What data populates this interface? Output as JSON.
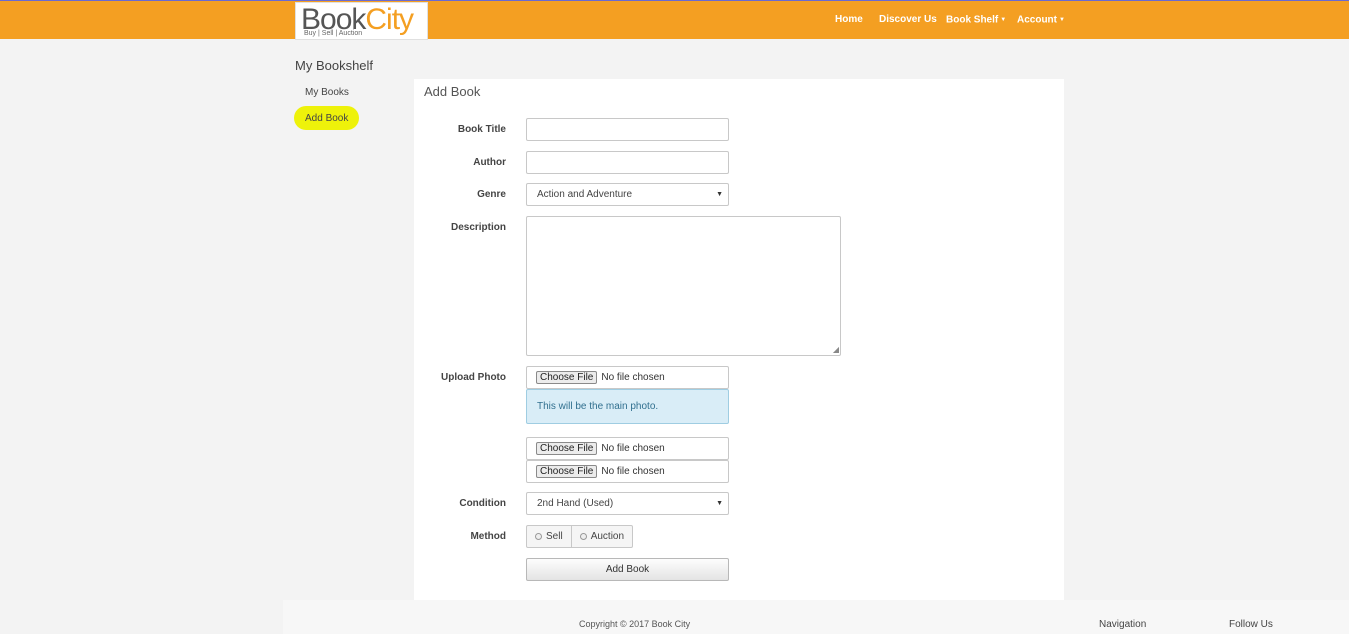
{
  "brand": {
    "name_part1": "Book",
    "name_part2": "City",
    "tagline": "Buy | Sell | Auction"
  },
  "nav": {
    "home": "Home",
    "discover": "Discover Us",
    "bookshelf": "Book Shelf",
    "account": "Account",
    "dropdown_caret": "▼"
  },
  "sidebar": {
    "title": "My Bookshelf",
    "items": [
      {
        "label": "My Books"
      },
      {
        "label": "Add Book"
      }
    ],
    "highlight_color": "#eef20a"
  },
  "form": {
    "title": "Add Book",
    "book_title": {
      "label": "Book Title",
      "value": ""
    },
    "author": {
      "label": "Author",
      "value": ""
    },
    "genre": {
      "label": "Genre",
      "selected": "Action and Adventure"
    },
    "description": {
      "label": "Description",
      "value": ""
    },
    "upload": {
      "label": "Upload Photo",
      "button": "Choose File",
      "status": "No file chosen",
      "main_photo_note": "This will be the main photo."
    },
    "condition": {
      "label": "Condition",
      "selected": "2nd Hand (Used)"
    },
    "method": {
      "label": "Method",
      "options": [
        "Sell",
        "Auction"
      ]
    },
    "submit": "Add Book"
  },
  "footer": {
    "copyright": "Copyright © 2017 Book City",
    "navigation": "Navigation",
    "follow_us": "Follow Us"
  },
  "colors": {
    "topbar": "#f49f22",
    "info_bg": "#d9edf7",
    "info_text": "#31708f"
  }
}
